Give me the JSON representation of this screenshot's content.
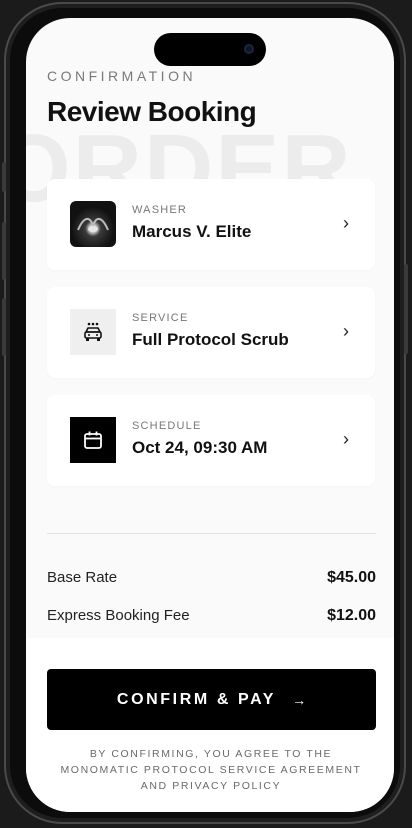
{
  "header": {
    "eyebrow": "CONFIRMATION",
    "title": "Review Booking",
    "watermark": "ORDER"
  },
  "cards": {
    "washer": {
      "label": "WASHER",
      "value": "Marcus V. Elite",
      "icon": "washer-avatar"
    },
    "service": {
      "label": "SERVICE",
      "value": "Full Protocol Scrub",
      "icon": "car-wash-icon"
    },
    "schedule": {
      "label": "SCHEDULE",
      "value": "Oct 24, 09:30 AM",
      "icon": "calendar-icon"
    }
  },
  "pricing": {
    "base_rate_label": "Base Rate",
    "base_rate_value": "$45.00",
    "fee_label": "Express Booking Fee",
    "fee_value": "$12.00"
  },
  "cta": {
    "label": "CONFIRM & PAY",
    "arrow": "→"
  },
  "disclaimer": "BY CONFIRMING, YOU AGREE TO THE MONOMATIC PROTOCOL SERVICE AGREEMENT AND PRIVACY POLICY",
  "chevron": "›"
}
